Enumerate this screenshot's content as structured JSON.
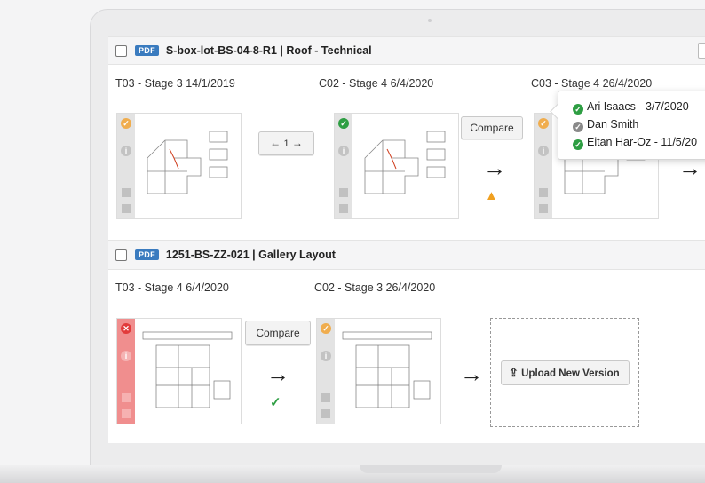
{
  "documents": [
    {
      "title": "S-box-lot-BS-04-8-R1 | Roof - Technical",
      "badge": "PDF",
      "versions": [
        {
          "label": "T03 - Stage 3 14/1/2019",
          "status": "pending"
        },
        {
          "label": "C02 - Stage 4 6/4/2020",
          "status": "approved"
        },
        {
          "label": "C03 - Stage 4 26/4/2020",
          "status": "pending"
        }
      ],
      "pager": "1",
      "compare_label": "Compare"
    },
    {
      "title": "1251-BS-ZZ-021 | Gallery Layout",
      "badge": "PDF",
      "versions": [
        {
          "label": "T03 - Stage 4 6/4/2020",
          "status": "rejected"
        },
        {
          "label": "C02 - Stage 3 26/4/2020",
          "status": "pending"
        }
      ],
      "compare_label": "Compare",
      "upload_label": "Upload New Version"
    }
  ],
  "tooltip": {
    "reviewers": [
      {
        "name": "Ari Isaacs - 3/7/2020",
        "status": "approved"
      },
      {
        "name": "Dan Smith",
        "status": "pending"
      },
      {
        "name": "Eitan Har-Oz - 11/5/20",
        "status": "approved"
      }
    ]
  },
  "colors": {
    "approved": "#2e9e43",
    "pending": "#f0ad4e",
    "rejected": "#e23b3b",
    "pdf_badge": "#3a7bbf",
    "warning": "#f0a020"
  },
  "icons": {
    "approved": "check-circle-icon",
    "pending": "check-circle-icon",
    "rejected": "x-circle-icon",
    "info": "info-icon",
    "download": "download-icon",
    "delete": "trash-icon",
    "warning": "warning-icon",
    "upload": "upload-icon"
  }
}
